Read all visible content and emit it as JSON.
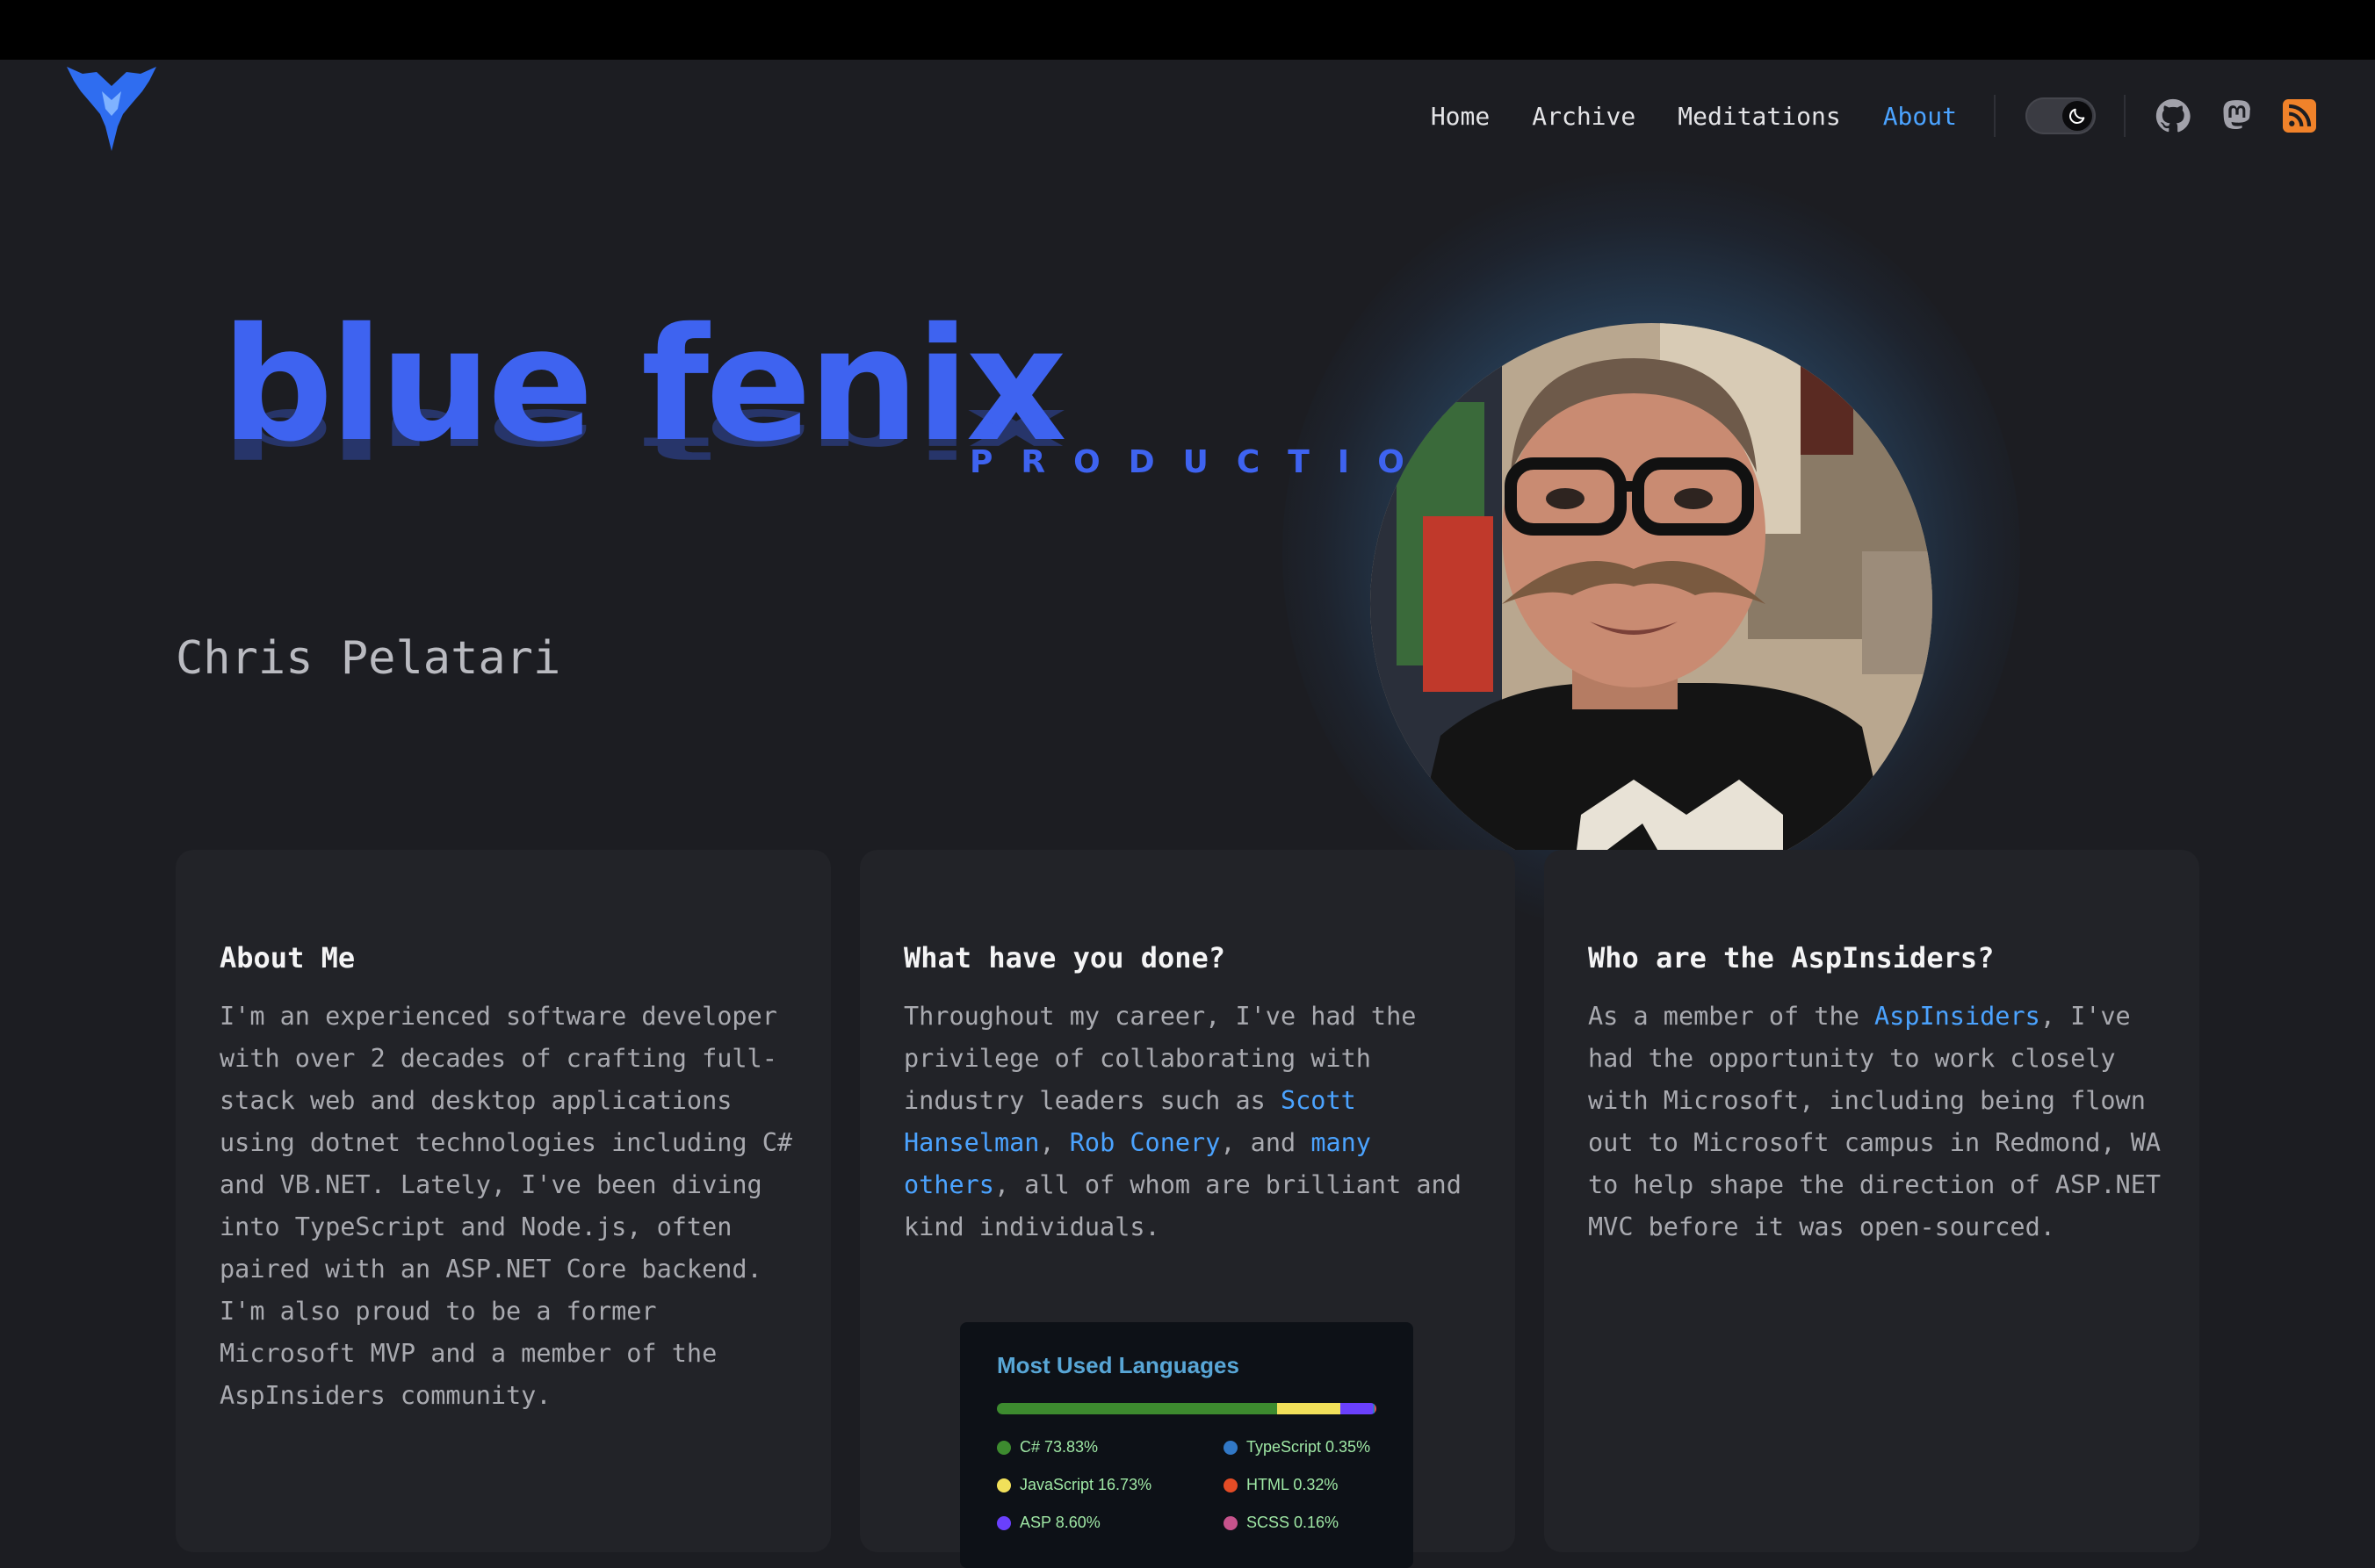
{
  "nav": {
    "items": [
      {
        "label": "Home",
        "active": false
      },
      {
        "label": "Archive",
        "active": false
      },
      {
        "label": "Meditations",
        "active": false
      },
      {
        "label": "About",
        "active": true
      }
    ],
    "theme_toggle": {
      "state": "dark",
      "icon": "moon-icon"
    },
    "social": [
      {
        "icon": "github-icon"
      },
      {
        "icon": "mastodon-icon"
      },
      {
        "icon": "rss-icon"
      }
    ]
  },
  "hero": {
    "brand_main": "blue fenix",
    "brand_sub": "PRODUCTION",
    "name": "Chris Pelatari"
  },
  "cards": [
    {
      "title": "About Me",
      "body": "I'm an experienced software developer with over 2 decades of crafting full-stack web and desktop applications using dotnet technologies including C# and VB.NET. Lately, I've been diving into TypeScript and Node.js, often paired with an ASP.NET Core backend. I'm also proud to be a former Microsoft MVP and a member of the AspInsiders community."
    },
    {
      "title": "What have you done?",
      "body_parts": [
        {
          "text": "Throughout my career, I've had the privilege of collaborating with industry leaders such as "
        },
        {
          "link": "Scott Hanselman"
        },
        {
          "text": ", "
        },
        {
          "link": "Rob Conery"
        },
        {
          "text": ", and "
        },
        {
          "link": "many others"
        },
        {
          "text": ", all of whom are brilliant and kind individuals."
        }
      ]
    },
    {
      "title": "Who are the AspInsiders?",
      "body_parts": [
        {
          "text": "As a member of the "
        },
        {
          "link": "AspInsiders"
        },
        {
          "text": ", I've had the opportunity to work closely with Microsoft, including being flown out to Microsoft campus in Redmond, WA to help shape the direction of ASP.NET MVC before it was open-sourced."
        }
      ]
    }
  ],
  "languages_widget": {
    "title": "Most Used Languages",
    "languages": [
      {
        "name": "C#",
        "percent": "73.83%",
        "value": 73.83,
        "color": "#3d8b2f"
      },
      {
        "name": "TypeScript",
        "percent": "0.35%",
        "value": 0.35,
        "color": "#3178c6"
      },
      {
        "name": "JavaScript",
        "percent": "16.73%",
        "value": 16.73,
        "color": "#f1e05a"
      },
      {
        "name": "HTML",
        "percent": "0.32%",
        "value": 0.32,
        "color": "#e34c26"
      },
      {
        "name": "ASP",
        "percent": "8.60%",
        "value": 8.6,
        "color": "#6a40fd"
      },
      {
        "name": "SCSS",
        "percent": "0.16%",
        "value": 0.16,
        "color": "#c6538c"
      }
    ]
  },
  "colors": {
    "accent": "#4ba3ff",
    "brand": "#3e63f0",
    "background": "#1c1d22",
    "card": "#222328",
    "rss": "#f0822a"
  }
}
